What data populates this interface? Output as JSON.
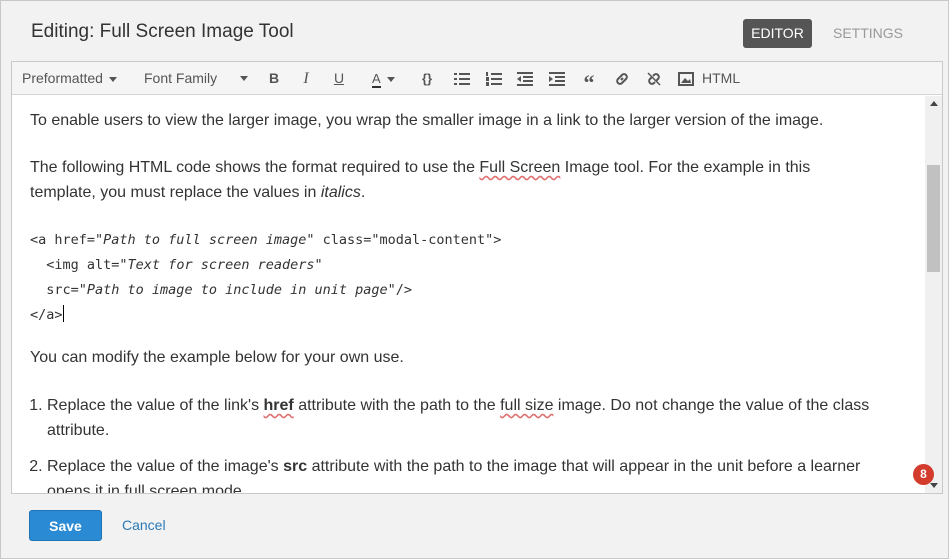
{
  "dialog": {
    "title": "Editing: Full Screen Image Tool",
    "tabs": {
      "editor": "EDITOR",
      "settings": "SETTINGS"
    }
  },
  "toolbar": {
    "format_select": "Preformatted",
    "font_select": "Font Family",
    "bold": "B",
    "italic": "I",
    "underline": "U",
    "font_color": "A",
    "code": "{}",
    "html": "HTML",
    "icons": [
      "bold-icon",
      "italic-icon",
      "underline-icon",
      "font-color-icon",
      "code-block-icon",
      "bulleted-list-icon",
      "numbered-list-icon",
      "outdent-icon",
      "indent-icon",
      "blockquote-icon",
      "link-icon",
      "unlink-icon",
      "image-icon"
    ]
  },
  "content": {
    "p1": "To enable users to view the larger image, you wrap the smaller image in a link to the larger version of the image.",
    "p2_before": "The following HTML code shows the format required to use the ",
    "p2_link": "Full Screen",
    "p2_middle": " Image tool. For the example in this template, you must replace the values in ",
    "p2_italic": "italics",
    "p2_end": ".",
    "code": {
      "l1_a": "<a href=\"",
      "l1_i": "Path to full screen image",
      "l1_b": "\" class=\"modal-content\">",
      "l2_a": "  <img alt=\"",
      "l2_i": "Text for screen readers",
      "l2_b": "\"",
      "l3_a": "  src=\"",
      "l3_i": "Path to image to include in unit page",
      "l3_b": "\"/>",
      "l4": "</a>"
    },
    "p3": "You can modify the example below for your own use.",
    "li1_a": "Replace the value of the link's ",
    "li1_b": "href",
    "li1_c": " attribute with the path to the ",
    "li1_d": "full size",
    "li1_e": " image. Do not change the value of the class attribute.",
    "li2_a": "Replace the value of the image's ",
    "li2_b": "src",
    "li2_c": " attribute with the path to the image that will appear in the unit before a learner opens it in full screen mode."
  },
  "badge": {
    "count": "8"
  },
  "footer": {
    "save": "Save",
    "cancel": "Cancel"
  },
  "colors": {
    "primary": "#2a8ad4",
    "active_tab": "#555555",
    "badge": "#d33b2c"
  }
}
